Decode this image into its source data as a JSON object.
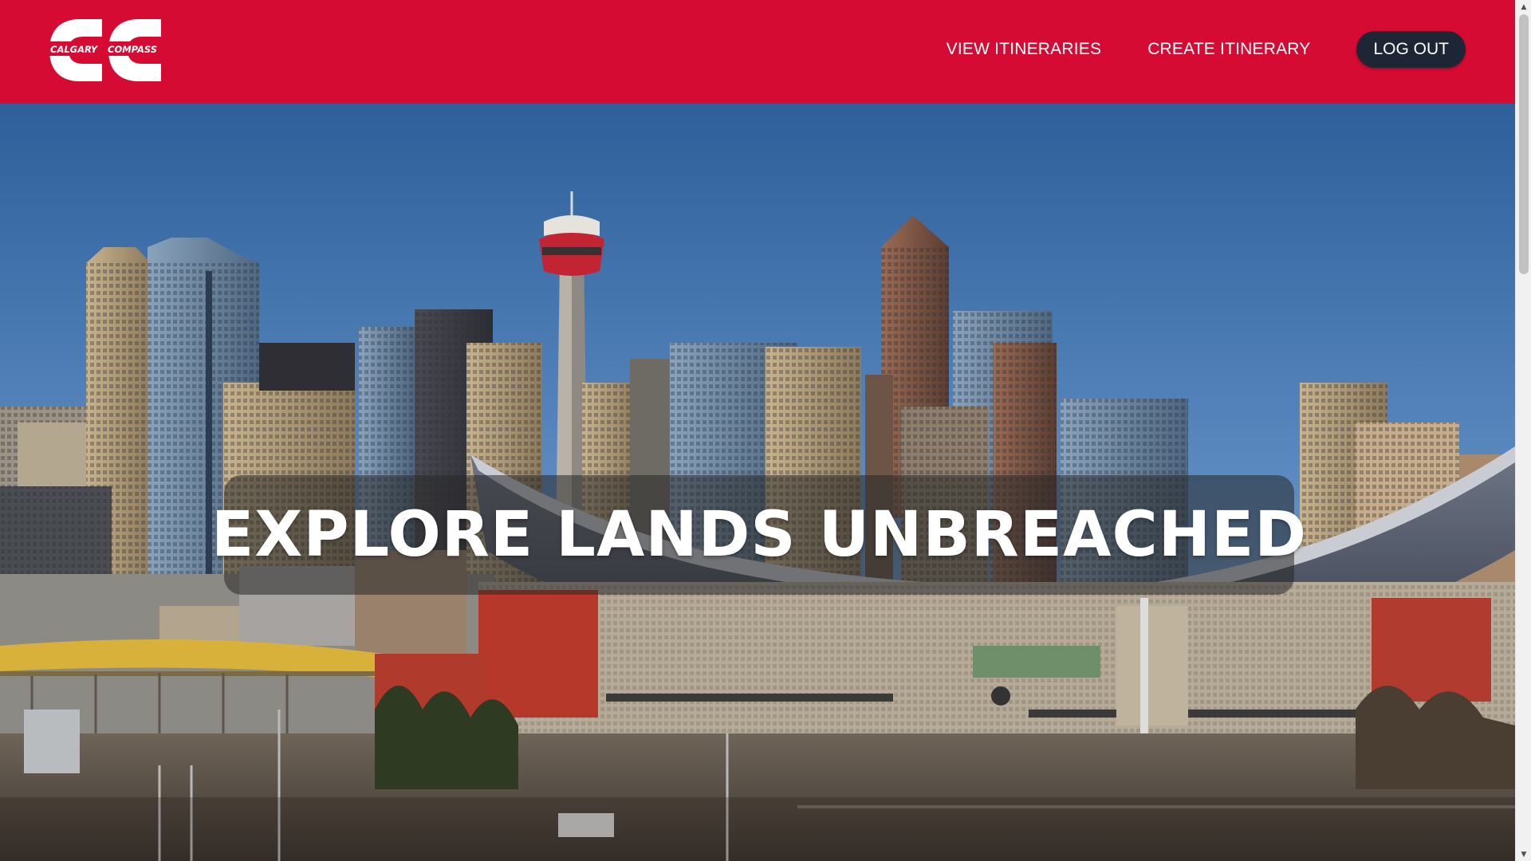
{
  "header": {
    "logo": {
      "text_left": "CALGARY",
      "text_right": "COMPASS",
      "icon": "calgary-compass-logo"
    },
    "nav": {
      "view_itineraries": "VIEW ITINERARIES",
      "create_itinerary": "CREATE ITINERARY",
      "log_out": "LOG OUT"
    },
    "colors": {
      "brand_red": "#d50b33",
      "button_dark": "#1e2535",
      "text": "#ffffff"
    }
  },
  "hero": {
    "tagline": "EXPLORE LANDS UNBREACHED",
    "image": "calgary-skyline-saddledome-photo"
  },
  "scrollbar": {
    "up_icon": "scroll-up-arrow-icon",
    "down_icon": "scroll-down-arrow-icon"
  }
}
